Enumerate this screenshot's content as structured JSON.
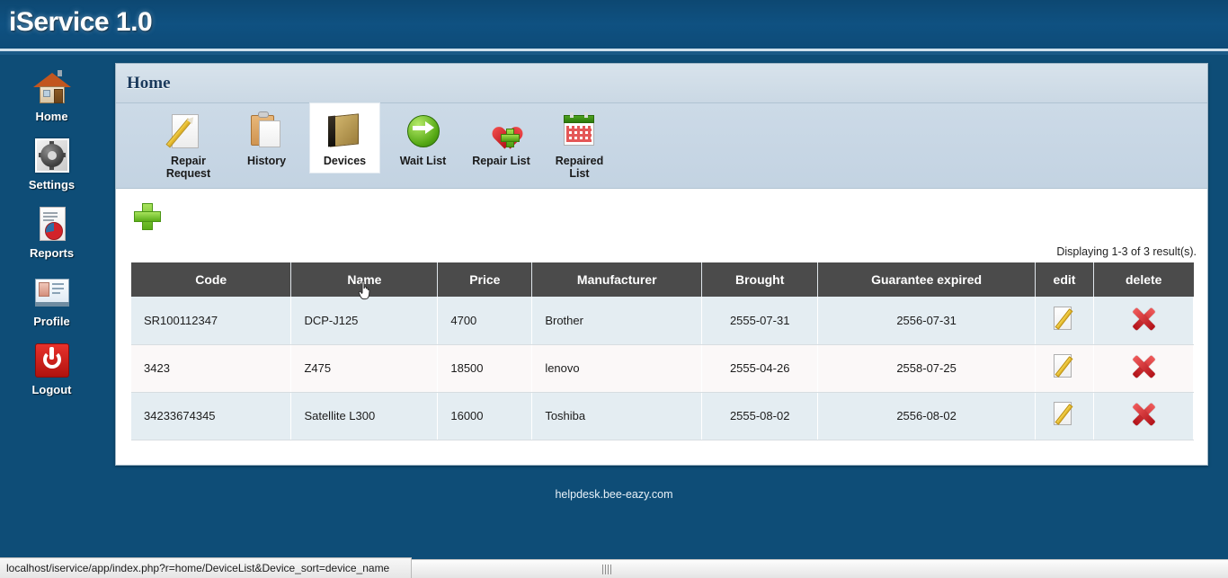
{
  "app": {
    "title": "iService 1.0",
    "footer": "helpdesk.bee-eazy.com",
    "accent": "#0e4d77",
    "header_color": "#0f5181"
  },
  "sidebar": {
    "items": [
      {
        "label": "Home",
        "icon": "house-icon"
      },
      {
        "label": "Settings",
        "icon": "gear-icon"
      },
      {
        "label": "Reports",
        "icon": "report-chart-icon"
      },
      {
        "label": "Profile",
        "icon": "id-card-icon"
      },
      {
        "label": "Logout",
        "icon": "power-icon"
      }
    ]
  },
  "panel": {
    "title": "Home",
    "tabs": [
      {
        "label": "Repair Request",
        "icon": "paper-pencil-icon",
        "active": false
      },
      {
        "label": "History",
        "icon": "clipboard-icon",
        "active": false
      },
      {
        "label": "Devices",
        "icon": "book-icon",
        "active": true
      },
      {
        "label": "Wait List",
        "icon": "green-arrow-icon",
        "active": false
      },
      {
        "label": "Repair List",
        "icon": "heart-plus-icon",
        "active": false
      },
      {
        "label": "Repaired List",
        "icon": "calendar-icon",
        "active": false
      }
    ],
    "add_button": "add-icon",
    "summary": "Displaying 1-3 of 3 result(s).",
    "table": {
      "columns": [
        "Code",
        "Name",
        "Price",
        "Manufacturer",
        "Brought",
        "Guarantee expired",
        "edit",
        "delete"
      ],
      "rows": [
        {
          "code": "SR100112347",
          "name": "DCP-J125",
          "price": "4700",
          "manufacturer": "Brother",
          "brought": "2555-07-31",
          "guarantee_expired": "2556-07-31"
        },
        {
          "code": "3423",
          "name": "Z475",
          "price": "18500",
          "manufacturer": "lenovo",
          "brought": "2555-04-26",
          "guarantee_expired": "2558-07-25"
        },
        {
          "code": "34233674345",
          "name": "Satellite L300",
          "price": "16000",
          "manufacturer": "Toshiba",
          "brought": "2555-08-02",
          "guarantee_expired": "2556-08-02"
        }
      ],
      "row_actions": {
        "edit": "edit-pencil-icon",
        "delete": "delete-x-icon"
      }
    }
  },
  "statusbar": {
    "url": "localhost/iservice/app/index.php?r=home/DeviceList&Device_sort=device_name"
  }
}
